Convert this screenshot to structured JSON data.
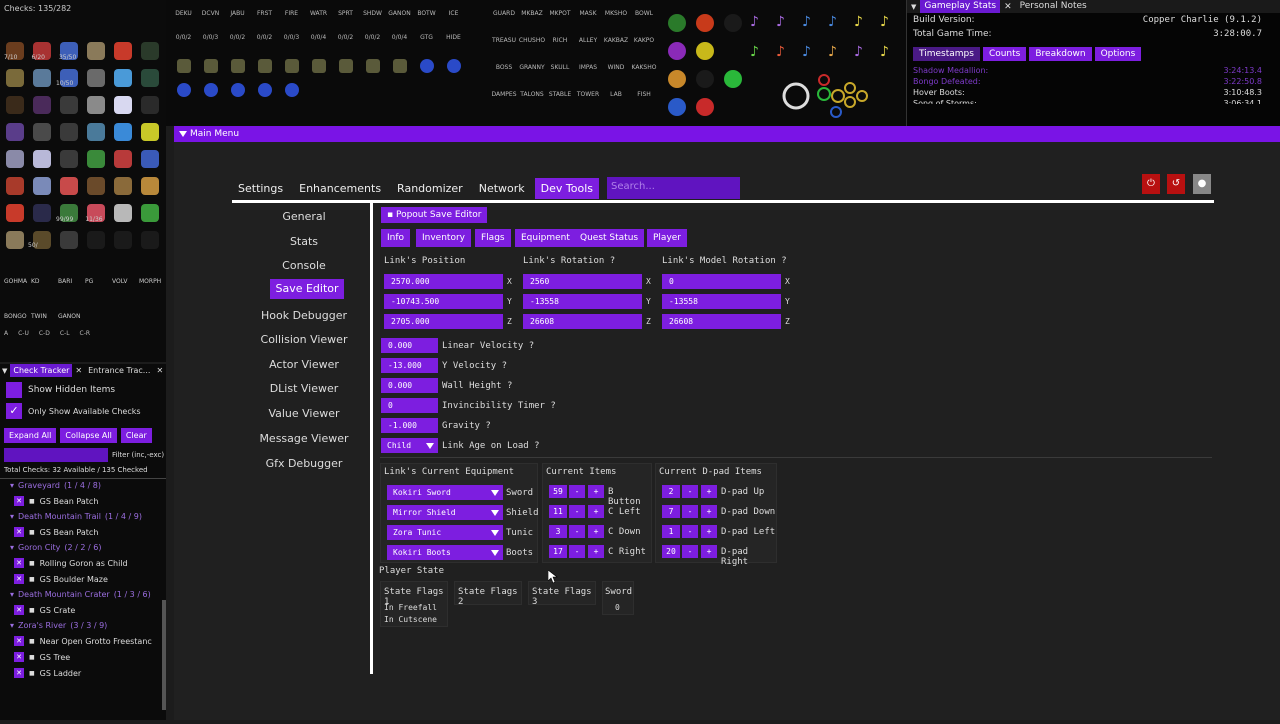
{
  "item_tracker": {
    "checks_label": "Checks: 135/282",
    "counters": [
      "7/10",
      "6/20",
      "35/50",
      "10/50",
      "99/99",
      "11/36",
      "50/"
    ],
    "dungeon_labels": [
      "GOHMA",
      "KD",
      "BARI",
      "PG",
      "VOLV",
      "MORPH",
      "BONGO",
      "TWIN",
      "GANON"
    ],
    "slot_labels": [
      "A",
      "C-U",
      "C-D",
      "C-L",
      "C-R"
    ]
  },
  "top_strip": {
    "song_labels": [
      "DEKU",
      "DCVN",
      "JABU",
      "FRST",
      "FIRE",
      "WATR",
      "SPRT",
      "SHDW",
      "GANON",
      "BOTW",
      "ICE",
      "GTG"
    ],
    "song_counts": [
      "0/0/2",
      "0/0/3",
      "0/0/2",
      "0/0/2",
      "0/0/3",
      "0/0/4",
      "0/0/2",
      "0/0/2",
      "0/0/4"
    ],
    "hide_label": "HIDE",
    "location_labels": [
      "GUARD",
      "MKBAZ",
      "MKPOT",
      "MASK",
      "MKSHO",
      "BOWL",
      "TREASU",
      "CHUSHO",
      "RICH",
      "ALLEY",
      "KAKBAZ",
      "KAKPO",
      "BOSS",
      "GRANNY",
      "SKULL",
      "IMPAS",
      "WIND",
      "KAKSHO",
      "DAMPES",
      "TALONS",
      "STABLE",
      "TOWER",
      "LAB",
      "FISH"
    ]
  },
  "gameplay_stats": {
    "tabs": [
      "Gameplay Stats",
      "Personal Notes"
    ],
    "build_label": "Build Version:",
    "build_value": "Copper Charlie (9.1.2)",
    "time_label": "Total Game Time:",
    "time_value": "3:28:00.7",
    "subtabs": [
      "Timestamps",
      "Counts",
      "Breakdown",
      "Options"
    ],
    "timestamps": [
      {
        "name": "Shadow Medallion:",
        "time": "3:24:13.4"
      },
      {
        "name": "Bongo Defeated:",
        "time": "3:22:50.8"
      },
      {
        "name": "Hover Boots:",
        "time": "3:10:48.3"
      },
      {
        "name": "Song of Storms:",
        "time": "3:06:34.1"
      }
    ]
  },
  "main_menu": {
    "title": "Main Menu",
    "nav": [
      "Settings",
      "Enhancements",
      "Randomizer",
      "Network",
      "Dev Tools"
    ],
    "search_placeholder": "Search...",
    "right_buttons": [
      "power-icon",
      "reset-icon",
      "gear-icon"
    ],
    "side_items": [
      "General",
      "Stats",
      "Console",
      "Save Editor",
      "Hook Debugger",
      "Collision Viewer",
      "Actor Viewer",
      "DList Viewer",
      "Value Viewer",
      "Message Viewer",
      "Gfx Debugger"
    ]
  },
  "save_editor": {
    "popout_label": "Popout Save Editor",
    "tabs": [
      "Info",
      "Inventory",
      "Flags",
      "Equipment",
      "Quest Status",
      "Player"
    ],
    "position_label": "Link's Position",
    "rotation_label": "Link's Rotation",
    "model_rotation_label": "Link's Model Rotation",
    "help": "?",
    "axes": [
      "X",
      "Y",
      "Z"
    ],
    "position": [
      "2570.000",
      "-10743.500",
      "2705.000"
    ],
    "rotation": [
      "2560",
      "-13558",
      "26608"
    ],
    "model_rotation": [
      "0",
      "-13558",
      "26608"
    ],
    "scalars": [
      {
        "value": "0.000",
        "label": "Linear Velocity"
      },
      {
        "value": "-13.000",
        "label": "Y Velocity"
      },
      {
        "value": "0.000",
        "label": "Wall Height"
      },
      {
        "value": "0",
        "label": "Invincibility Timer"
      },
      {
        "value": "-1.000",
        "label": "Gravity"
      }
    ],
    "age": {
      "value": "Child",
      "label": "Link Age on Load"
    },
    "equipment_title": "Link's Current Equipment",
    "equipment": [
      {
        "value": "Kokiri Sword",
        "label": "Sword"
      },
      {
        "value": "Mirror Shield",
        "label": "Shield"
      },
      {
        "value": "Zora Tunic",
        "label": "Tunic"
      },
      {
        "value": "Kokiri Boots",
        "label": "Boots"
      }
    ],
    "items_title": "Current Items",
    "items": [
      {
        "value": "59",
        "label": "B Button"
      },
      {
        "value": "11",
        "label": "C Left"
      },
      {
        "value": "3",
        "label": "C Down"
      },
      {
        "value": "17",
        "label": "C Right"
      }
    ],
    "dpad_title": "Current D-pad Items",
    "dpad": [
      {
        "value": "2",
        "label": "D-pad Up"
      },
      {
        "value": "7",
        "label": "D-pad Down"
      },
      {
        "value": "1",
        "label": "D-pad Left"
      },
      {
        "value": "20",
        "label": "D-pad Right"
      }
    ],
    "minus": "-",
    "plus": "+",
    "player_state_title": "Player State",
    "state_flags": [
      "State Flags 1",
      "State Flags 2",
      "State Flags 3"
    ],
    "state_flag1_values": [
      "In Freefall",
      "In Cutscene"
    ],
    "sword_label": "Sword",
    "sword_value": "0"
  },
  "check_tracker": {
    "tabs": [
      "Check Tracker",
      "Entrance Trac..."
    ],
    "show_hidden": "Show Hidden Items",
    "only_available": "Only Show Available Checks",
    "check_mark": "✓",
    "buttons": [
      "Expand All",
      "Collapse All",
      "Clear"
    ],
    "filter_label": "Filter (inc,-exc)",
    "total": "Total Checks: 32 Available / 135 Checked",
    "areas": [
      {
        "name": "Graveyard",
        "count": "(1 / 4 / 8)",
        "items": [
          "GS Bean Patch"
        ]
      },
      {
        "name": "Death Mountain Trail",
        "count": "(1 / 4 / 9)",
        "items": [
          "GS Bean Patch"
        ]
      },
      {
        "name": "Goron City",
        "count": "(2 / 2 / 6)",
        "items": [
          "Rolling Goron as Child",
          "GS Boulder Maze"
        ]
      },
      {
        "name": "Death Mountain Crater",
        "count": "(1 / 3 / 6)",
        "items": [
          "GS Crate"
        ]
      },
      {
        "name": "Zora's River",
        "count": "(3 / 3 / 9)",
        "items": [
          "Near Open Grotto Freestanc",
          "GS Tree",
          "GS Ladder"
        ]
      }
    ]
  },
  "colors": {
    "accent": "#7d1ee0",
    "accent_dark": "#6014c0",
    "danger": "#b81010",
    "bg": "#202020"
  }
}
